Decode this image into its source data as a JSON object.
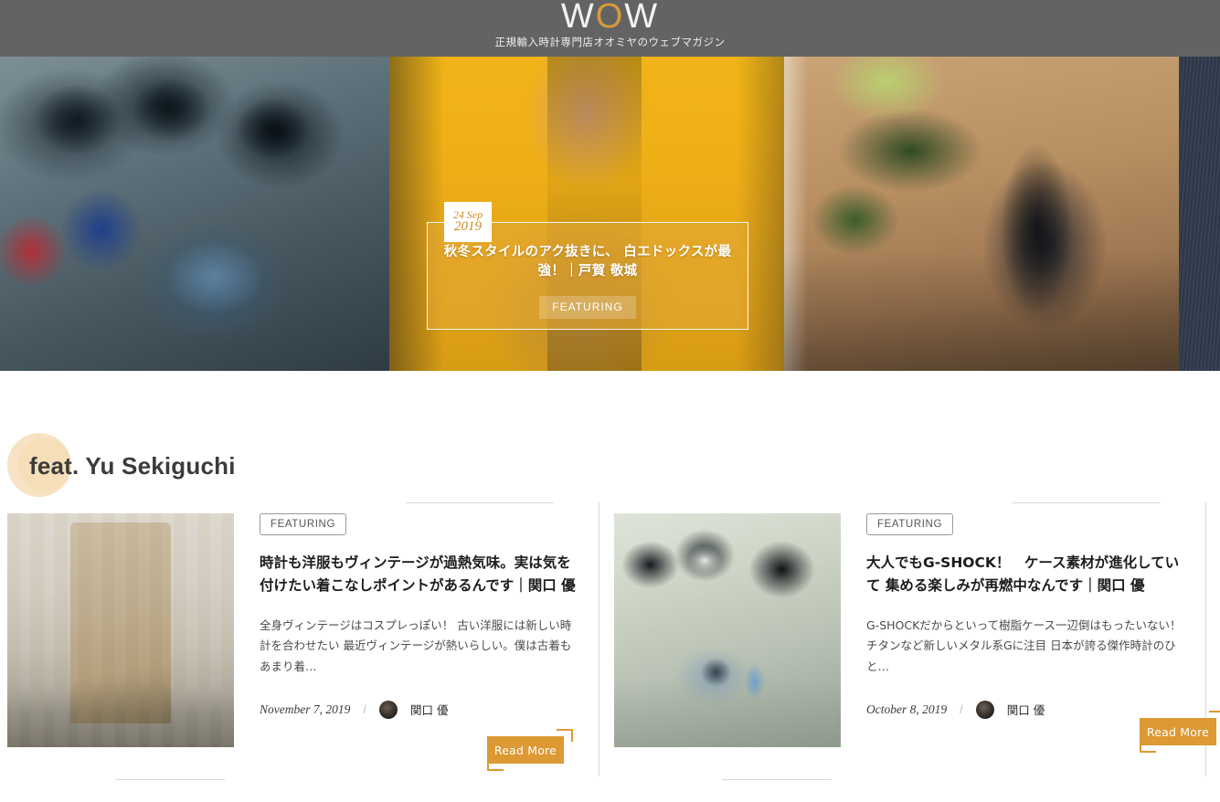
{
  "header": {
    "logo_w1": "W",
    "logo_o": "O",
    "logo_w2": "W",
    "tagline": "正規輸入時計専門店オオミヤのウェブマガジン",
    "background_color": "#636363",
    "accent_color": "#d89b3b"
  },
  "hero": {
    "date_day": "24 Sep",
    "date_year": "2019",
    "title": "秋冬スタイルのアク抜きに、 白エドックスが最強！｜戸賀 敬城",
    "tag": "FEATURING",
    "overlay_color": "#e2a632",
    "slides": [
      {
        "name": "dark-gshock-watches"
      },
      {
        "name": "man-yellow-wall-portrait"
      },
      {
        "name": "man-plant-wood-wall"
      },
      {
        "name": "dark-knit-sliver"
      }
    ]
  },
  "feat_section": {
    "heading": "feat. Yu Sekiguchi",
    "circle_color": "#f7e3c4"
  },
  "cards": [
    {
      "badge": "FEATURING",
      "title": "時計も洋服もヴィンテージが過熱気味。実は気を付けたい着こなしポイントがあるんです｜関口 優",
      "excerpt": "全身ヴィンテージはコスプレっぽい！ 古い洋服には新しい時計を合わせたい 最近ヴィンテージが熱いらしい。僕は古着もあまり着…",
      "date": "November 7, 2019",
      "separator": "/",
      "author": "関口 優",
      "read_more": "Read More",
      "thumb_name": "trench-coat-shop-photo"
    },
    {
      "badge": "FEATURING",
      "title": "大人でもG-SHOCK！　ケース素材が進化していて 集める楽しみが再燃中なんです｜関口 優",
      "excerpt": "G-SHOCKだからといって樹脂ケース一辺倒はもったいない！ チタンなど新しいメタル系Gに注目 日本が誇る傑作時計のひと…",
      "date": "October 8, 2019",
      "separator": "/",
      "author": "関口 優",
      "read_more": "Read More",
      "thumb_name": "gshock-watches-photo"
    }
  ],
  "colors": {
    "button_orange": "#dd9933",
    "text_dark": "#1c1c1c",
    "border_light": "#d9d9d9"
  }
}
